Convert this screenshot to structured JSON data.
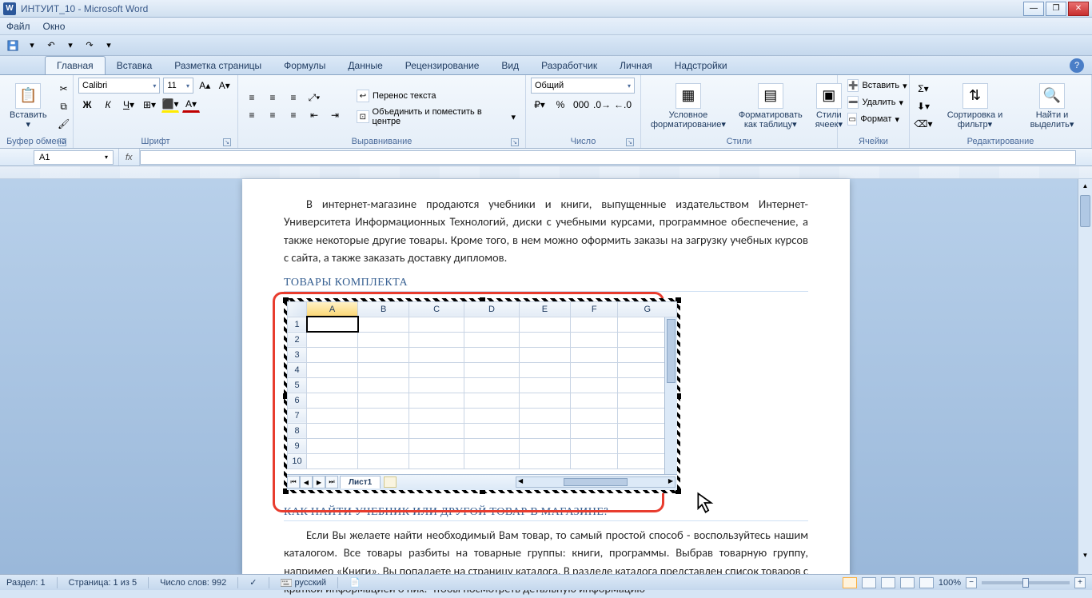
{
  "titlebar": {
    "title": "ИНТУИТ_10 - Microsoft Word"
  },
  "menu": {
    "file": "Файл",
    "window": "Окно"
  },
  "tabs": {
    "home": "Главная",
    "insert": "Вставка",
    "layout": "Разметка страницы",
    "formulas": "Формулы",
    "data": "Данные",
    "review": "Рецензирование",
    "view": "Вид",
    "developer": "Разработчик",
    "personal": "Личная",
    "addins": "Надстройки"
  },
  "ribbon": {
    "clipboard": {
      "paste": "Вставить",
      "label": "Буфер обмена"
    },
    "font": {
      "name": "Calibri",
      "size": "11",
      "label": "Шрифт"
    },
    "align": {
      "wrap": "Перенос текста",
      "merge": "Объединить и поместить в центре",
      "label": "Выравнивание"
    },
    "number": {
      "format": "Общий",
      "label": "Число"
    },
    "styles": {
      "cond": "Условное форматирование",
      "table": "Форматировать как таблицу",
      "cell": "Стили ячеек",
      "label": "Стили"
    },
    "cells": {
      "insert": "Вставить",
      "delete": "Удалить",
      "format": "Формат",
      "label": "Ячейки"
    },
    "editing": {
      "sort": "Сортировка и фильтр",
      "find": "Найти и выделить",
      "label": "Редактирование"
    }
  },
  "formula": {
    "cell": "A1",
    "fx": "fx"
  },
  "doc": {
    "p1": "В интернет-магазине продаются учебники и книги, выпущенные издательством Интернет-Университета Информационных Технологий, диски с учебными курсами, программное обеспечение, а также некоторые другие товары. Кроме того, в нем можно оформить заказы на загрузку учебных курсов с сайта, а также заказать доставку дипломов.",
    "h1": "ТОВАРЫ КОМПЛЕКТА",
    "h2": "КАК НАЙТИ УЧЕБНИК ИЛИ ДРУГОЙ ТОВАР В МАГАЗИНЕ?",
    "p2": "Если Вы желаете найти необходимый Вам товар, то самый простой способ - воспользуйтесь нашим каталогом. Все товары разбиты на товарные группы: книги, программы. Выбрав товарную группу, например «Книги», Вы попадаете на страницу каталога. В разделе каталога представлен список товаров с краткой информацией о них. Чтобы посмотреть детальную информацию"
  },
  "sheet": {
    "cols": [
      "A",
      "B",
      "C",
      "D",
      "E",
      "F",
      "G"
    ],
    "rows": [
      "1",
      "2",
      "3",
      "4",
      "5",
      "6",
      "7",
      "8",
      "9",
      "10"
    ],
    "tab": "Лист1"
  },
  "status": {
    "section": "Раздел: 1",
    "page": "Страница: 1 из 5",
    "words": "Число слов: 992",
    "lang": "русский",
    "zoom": "100%"
  }
}
